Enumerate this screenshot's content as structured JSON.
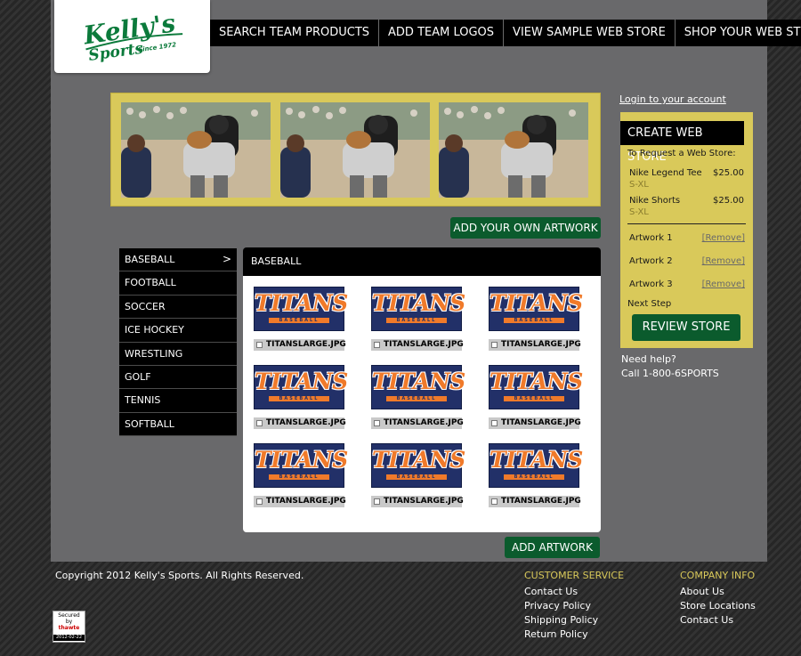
{
  "brand": {
    "logo_text": "Kelly's",
    "logo_sub": "Sports",
    "logo_since": "Since 1972",
    "brand_color": "#0b7a3b"
  },
  "top_nav": [
    {
      "label": "SEARCH TEAM PRODUCTS"
    },
    {
      "label": "ADD TEAM LOGOS"
    },
    {
      "label": "VIEW SAMPLE WEB STORE"
    },
    {
      "label": "SHOP YOUR WEB STORE"
    }
  ],
  "banner": {
    "photos": 3,
    "border_color": "#d9c95a"
  },
  "buttons": {
    "add_own_artwork": "ADD YOUR OWN ARTWORK",
    "add_artwork": "ADD ARTWORK",
    "review_store": "REVIEW STORE"
  },
  "categories": [
    {
      "label": "BASEBALL",
      "active": true,
      "chevron": ">"
    },
    {
      "label": "FOOTBALL"
    },
    {
      "label": "SOCCER"
    },
    {
      "label": "ICE HOCKEY"
    },
    {
      "label": "WRESTLING"
    },
    {
      "label": "GOLF"
    },
    {
      "label": "TENNIS"
    },
    {
      "label": "SOFTBALL"
    }
  ],
  "gallery": {
    "header": "BASEBALL",
    "logo_title": "TITANS",
    "logo_sub": "BASEBALL",
    "items": [
      {
        "file": "TITANSLARGE.JPG"
      },
      {
        "file": "TITANSLARGE.JPG"
      },
      {
        "file": "TITANSLARGE.JPG"
      },
      {
        "file": "TITANSLARGE.JPG"
      },
      {
        "file": "TITANSLARGE.JPG"
      },
      {
        "file": "TITANSLARGE.JPG"
      },
      {
        "file": "TITANSLARGE.JPG"
      },
      {
        "file": "TITANSLARGE.JPG"
      },
      {
        "file": "TITANSLARGE.JPG"
      }
    ]
  },
  "account": {
    "login_link": "Login to your account"
  },
  "store_panel": {
    "title": "CREATE WEB STORE",
    "subtitle": "To Request a Web Store:",
    "products": [
      {
        "name": "Nike Legend Tee",
        "size": "S-XL",
        "price": "$25.00"
      },
      {
        "name": "Nike Shorts",
        "size": "S-XL",
        "price": "$25.00"
      }
    ],
    "artwork": [
      {
        "label": "Artwork 1",
        "action": "[Remove]"
      },
      {
        "label": "Artwork 2",
        "action": "[Remove]"
      },
      {
        "label": "Artwork 3",
        "action": "[Remove]"
      }
    ],
    "next_step": "Next Step"
  },
  "help": {
    "title": "Need help?",
    "phone": "Call 1-800-6SPORTS"
  },
  "footer": {
    "copyright": "Copyright 2012 Kelly's Sports. All Rights Reserved.",
    "customer_service": {
      "heading": "CUSTOMER SERVICE",
      "links": [
        "Contact Us",
        "Privacy Policy",
        "Shipping Policy",
        "Return Policy"
      ]
    },
    "company_info": {
      "heading": "COMPANY INFO",
      "links": [
        "About Us",
        "Store Locations",
        "Contact Us"
      ]
    },
    "seal": {
      "line1": "Secured",
      "line2": "by",
      "line3": "thawte",
      "date": "2012-02-22"
    }
  },
  "colors": {
    "panel": "#69696b",
    "accent_yellow": "#d9c95a",
    "button_green": "#0b5b2d",
    "titans_navy": "#223068",
    "titans_orange": "#f07a2a"
  }
}
